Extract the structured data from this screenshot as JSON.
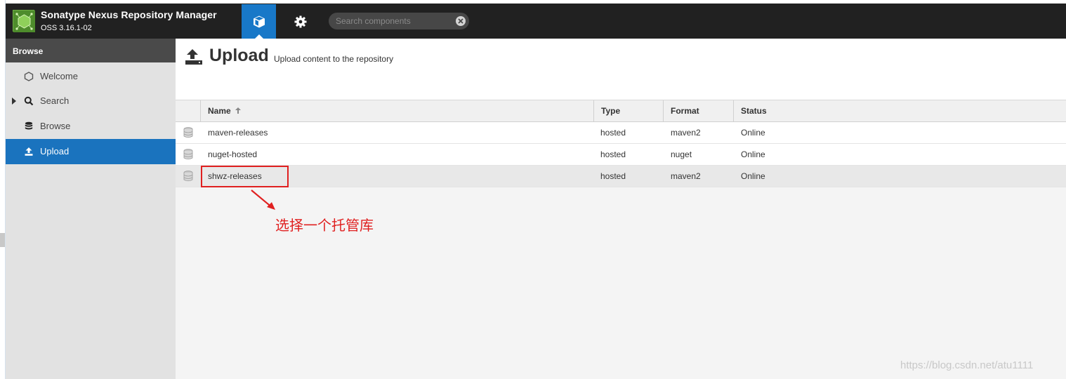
{
  "app": {
    "title": "Sonatype Nexus Repository Manager",
    "version": "OSS 3.16.1-02"
  },
  "header": {
    "search_placeholder": "Search components",
    "nav_browse_icon": "cube-icon",
    "nav_admin_icon": "gear-icon"
  },
  "sidebar": {
    "header": "Browse",
    "items": [
      {
        "label": "Welcome",
        "icon": "hexagon-icon"
      },
      {
        "label": "Search",
        "icon": "search-icon"
      },
      {
        "label": "Browse",
        "icon": "database-icon"
      },
      {
        "label": "Upload",
        "icon": "upload-icon",
        "active": true
      }
    ]
  },
  "page": {
    "title": "Upload",
    "subtitle": "Upload content to the repository"
  },
  "table": {
    "columns": [
      "Name",
      "Type",
      "Format",
      "Status"
    ],
    "rows": [
      {
        "name": "maven-releases",
        "type": "hosted",
        "format": "maven2",
        "status": "Online"
      },
      {
        "name": "nuget-hosted",
        "type": "hosted",
        "format": "nuget",
        "status": "Online"
      },
      {
        "name": "shwz-releases",
        "type": "hosted",
        "format": "maven2",
        "status": "Online"
      }
    ]
  },
  "annotation": {
    "text": "选择一个托管库"
  },
  "watermark": "https://blog.csdn.net/atu1111",
  "colors": {
    "header_bg": "#212121",
    "accent": "#1a73be",
    "annotation": "#e02020"
  }
}
